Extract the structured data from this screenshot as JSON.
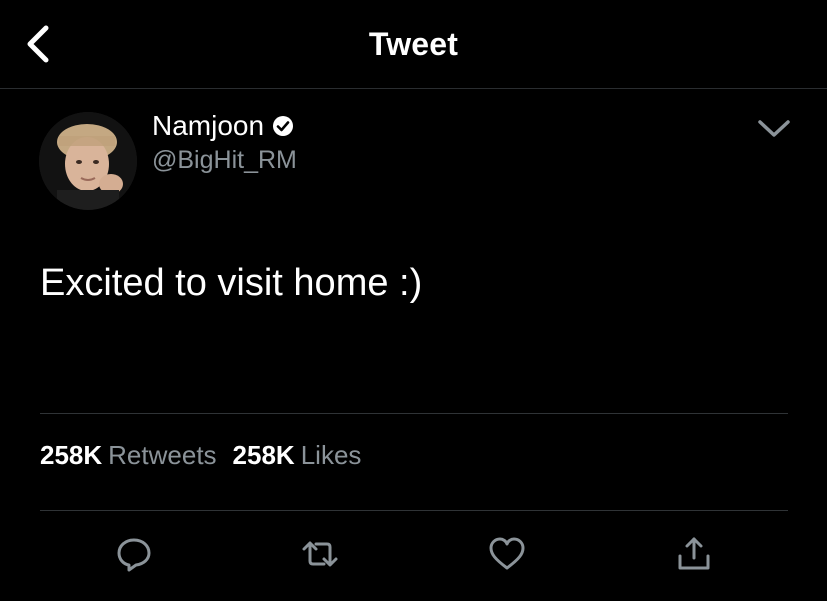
{
  "header": {
    "title": "Tweet",
    "back_icon": "chevron-left-icon"
  },
  "tweet": {
    "author": {
      "name": "Namjoon",
      "handle": "@BigHit_RM",
      "verified": true
    },
    "text": "Excited to visit home :)",
    "stats": {
      "retweets_count": "258K",
      "retweets_label": "Retweets",
      "likes_count": "258K",
      "likes_label": "Likes"
    }
  },
  "actions": [
    "reply-icon",
    "retweet-icon",
    "like-icon",
    "share-icon"
  ],
  "colors": {
    "background": "#000000",
    "text": "#ffffff",
    "secondary_text": "#8b9399",
    "divider": "#2f3336",
    "icon": "#8b9399"
  }
}
